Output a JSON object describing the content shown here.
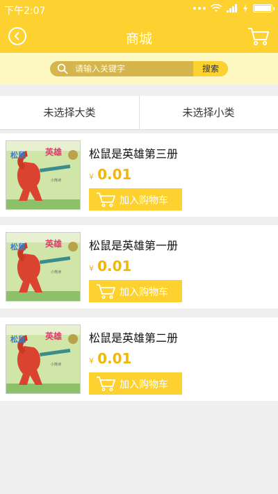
{
  "status_bar": {
    "time": "下午2:07"
  },
  "nav": {
    "title": "商城"
  },
  "search": {
    "placeholder": "请输入关键字",
    "button_label": "搜索"
  },
  "categories": {
    "major": "未选择大类",
    "minor": "未选择小类"
  },
  "products": [
    {
      "name": "松鼠是英雄第三册",
      "currency": "¥",
      "price": "0.01",
      "add_label": "加入购物车"
    },
    {
      "name": "松鼠是英雄第一册",
      "currency": "¥",
      "price": "0.01",
      "add_label": "加入购物车"
    },
    {
      "name": "松鼠是英雄第二册",
      "currency": "¥",
      "price": "0.01",
      "add_label": "加入购物车"
    }
  ],
  "colors": {
    "primary": "#fdd230",
    "search_bg": "#fef9c3",
    "price": "#f2b705"
  }
}
